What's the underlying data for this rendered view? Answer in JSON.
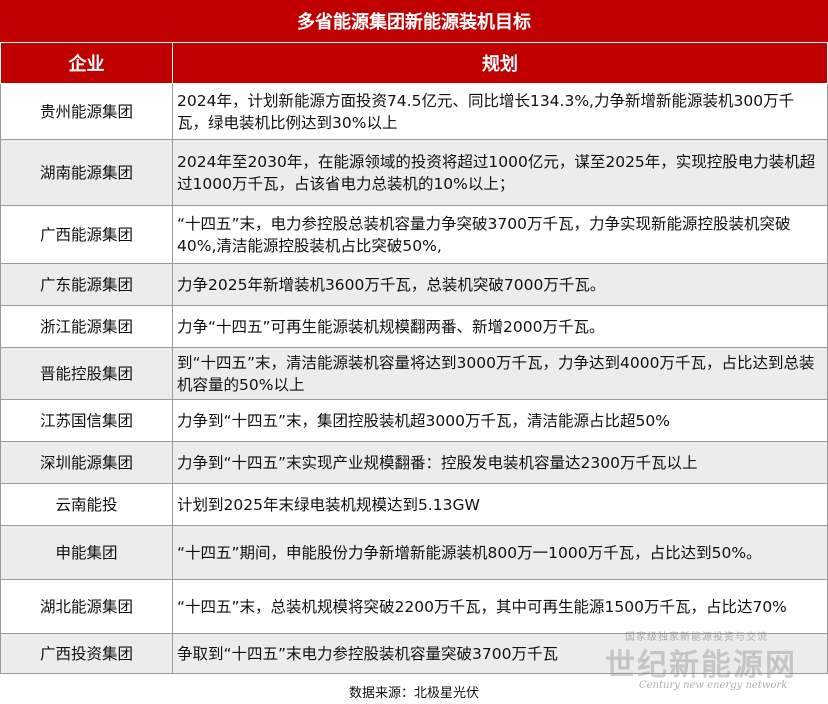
{
  "title": "多省能源集团新能源装机目标",
  "headers": {
    "company": "企业",
    "plan": "规划"
  },
  "rows": [
    {
      "company": "贵州能源集团",
      "plan": "2024年，计划新能源方面投资74.5亿元、同比增长134.3%,力争新增新能源装机300万千瓦，绿电装机比例达到30%以上"
    },
    {
      "company": "湖南能源集团",
      "plan": "2024年至2030年，在能源领域的投资将超过1000亿元，谋至2025年，实现控股电力装机超过1000万千瓦，占该省电力总装机的10%以上；"
    },
    {
      "company": "广西能源集团",
      "plan": "“十四五”末，电力参控股总装机容量力争突破3700万千瓦，力争实现新能源控股装机突破40%,清洁能源控股装机占比突破50%,"
    },
    {
      "company": "广东能源集团",
      "plan": "力争2025年新增装机3600万千瓦，总装机突破7000万千瓦。"
    },
    {
      "company": "浙江能源集团",
      "plan": "力争“十四五”可再生能源装机规模翻两番、新增2000万千瓦。"
    },
    {
      "company": "晋能控股集团",
      "plan": "到“十四五”末，清洁能源装机容量将达到3000万千瓦，力争达到4000万千瓦，占比达到总装机容量的50%以上"
    },
    {
      "company": "江苏国信集团",
      "plan": "力争到“十四五”末，集团控股装机超3000万千瓦，清洁能源占比超50%"
    },
    {
      "company": "深圳能源集团",
      "plan": "力争到“十四五”末实现产业规模翻番：控股发电装机容量达2300万千瓦以上"
    },
    {
      "company": "云南能投",
      "plan": "计划到2025年末绿电装机规模达到5.13GW"
    },
    {
      "company": "申能集团",
      "plan": "“十四五”期间，申能股份力争新增新能源装机800万一1000万千瓦，占比达到50%。"
    },
    {
      "company": "湖北能源集团",
      "plan": "“十四五”末，总装机规模将突破2200万千瓦，其中可再生能源1500万千瓦，占比达70%"
    },
    {
      "company": "广西投资集团",
      "plan": "争取到“十四五”末电力参控股装机容量突破3700万千瓦"
    }
  ],
  "source": "数据来源：北极星光伏",
  "watermark": {
    "top": "国家级独家新能源投资与交流",
    "main": "世纪新能源网",
    "sub": "Century new energy network"
  },
  "colors": {
    "header_bg": "#c00000",
    "header_text": "#ffffff",
    "stripe": "#ececec",
    "border": "#9a9a9a"
  }
}
